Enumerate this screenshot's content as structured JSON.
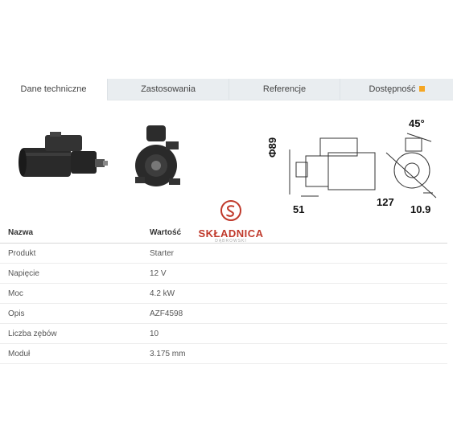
{
  "tabs": [
    {
      "label": "Dane techniczne",
      "active": true
    },
    {
      "label": "Zastosowania",
      "active": false
    },
    {
      "label": "Referencje",
      "active": false
    },
    {
      "label": "Dostępność",
      "active": false,
      "indicator_color": "#f5a623"
    }
  ],
  "logo": {
    "name": "SKŁADNICA",
    "sub": "DĄBROWSKI",
    "color": "#c0392b"
  },
  "dimensions": {
    "diameter": "Φ89",
    "length": "51",
    "angle": "45°",
    "width": "127",
    "offset": "10.9"
  },
  "table": {
    "headers": {
      "name": "Nazwa",
      "value": "Wartość"
    },
    "rows": [
      {
        "name": "Produkt",
        "value": "Starter"
      },
      {
        "name": "Napięcie",
        "value": "12 V"
      },
      {
        "name": "Moc",
        "value": "4.2 kW"
      },
      {
        "name": "Opis",
        "value": "AZF4598"
      },
      {
        "name": "Liczba zębów",
        "value": "10"
      },
      {
        "name": "Moduł",
        "value": "3.175 mm"
      }
    ]
  }
}
